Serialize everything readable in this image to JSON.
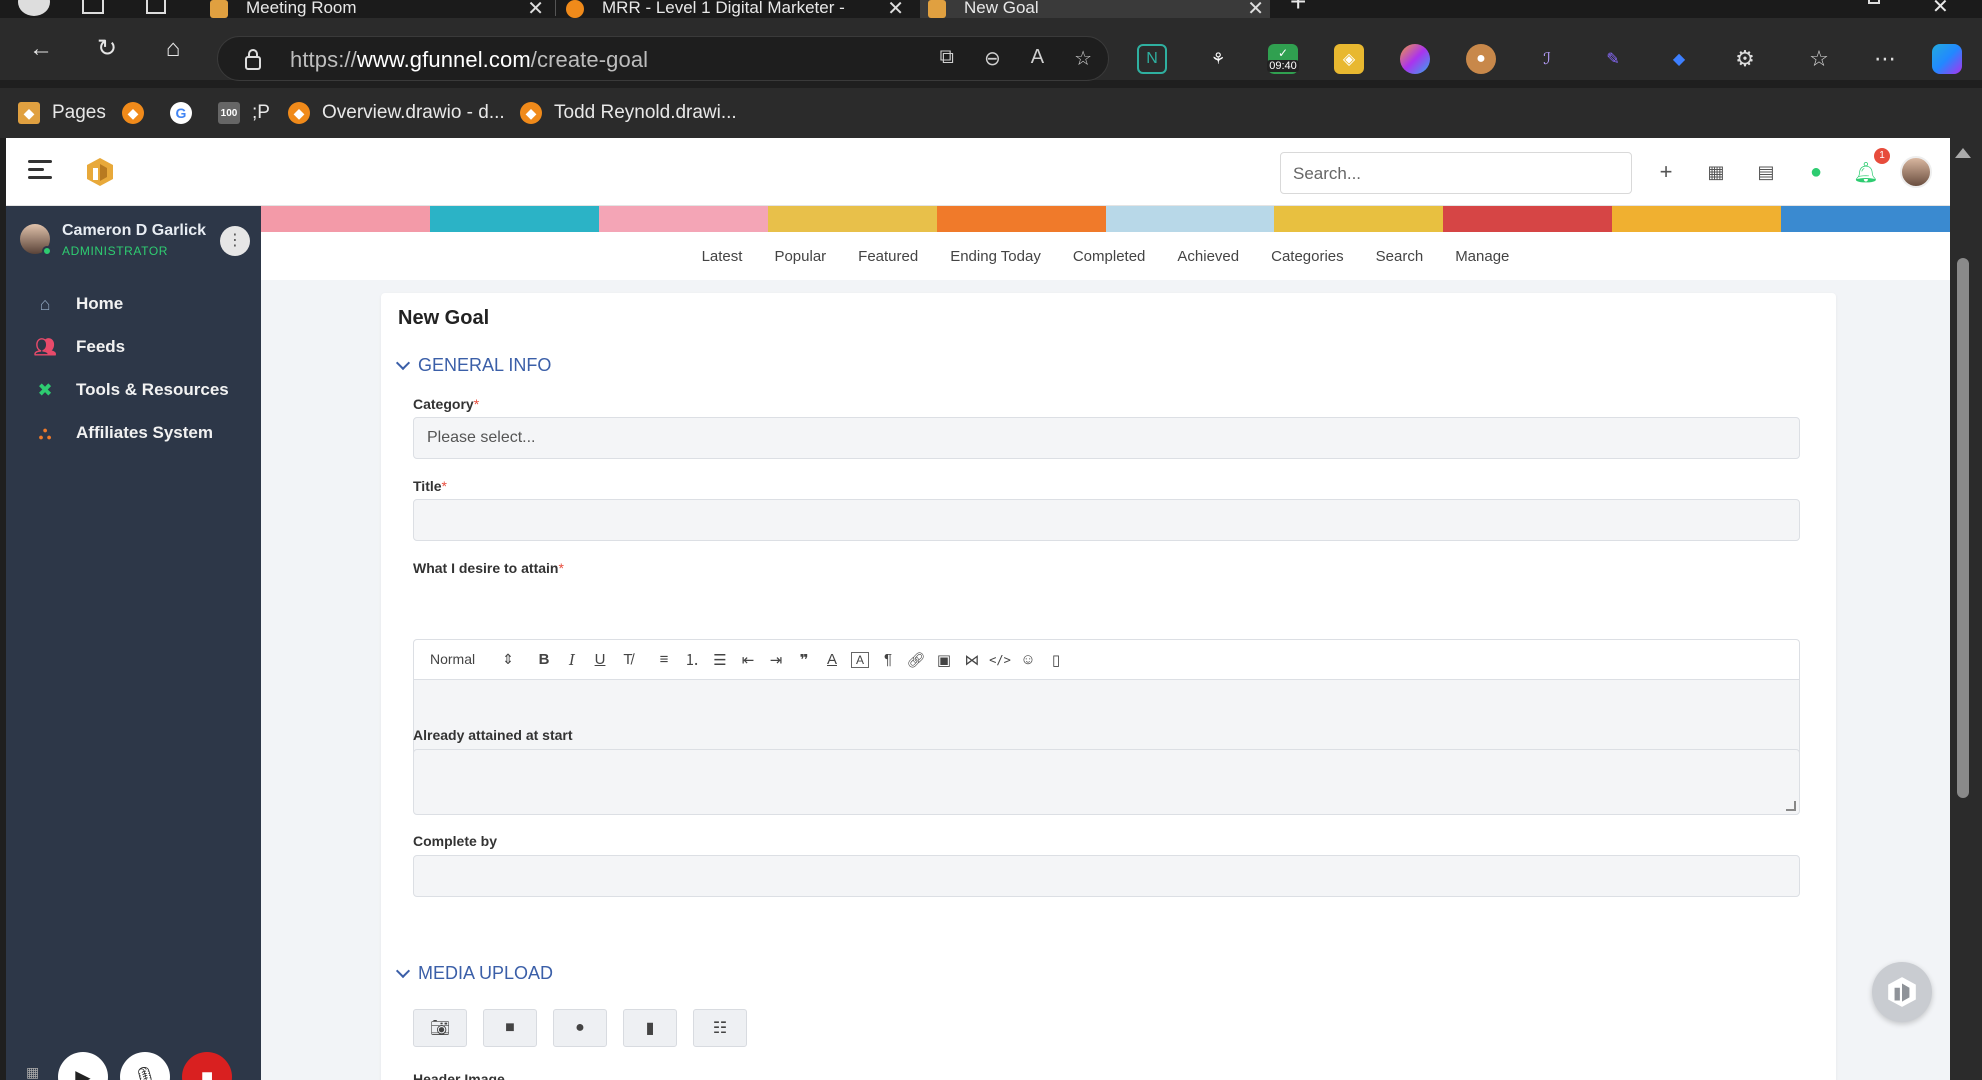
{
  "browser": {
    "tabs": [
      {
        "title": "Meeting Room"
      },
      {
        "title": "MRR - Level 1 Digital Marketer - "
      },
      {
        "title": "New Goal"
      }
    ],
    "url_prefix": "https://",
    "url_domain": "www.gfunnel.com",
    "url_path": "/create-goal",
    "extension_badge": "09:40",
    "bookmarks": [
      {
        "label": "Pages"
      },
      {
        "label": ""
      },
      {
        "label": ""
      },
      {
        "label": ";P"
      },
      {
        "label": "Overview.drawio - d..."
      },
      {
        "label": "Todd Reynold.drawi..."
      }
    ]
  },
  "app": {
    "search_placeholder": "Search...",
    "notification_count": "1",
    "user": {
      "name": "Cameron D Garlick",
      "role": "ADMINISTRATOR"
    },
    "sidebar": [
      {
        "label": "Home",
        "icon": "home-icon"
      },
      {
        "label": "Feeds",
        "icon": "users-icon"
      },
      {
        "label": "Tools & Resources",
        "icon": "tools-icon"
      },
      {
        "label": "Affiliates System",
        "icon": "sitemap-icon"
      }
    ],
    "subnav": [
      "Latest",
      "Popular",
      "Featured",
      "Ending Today",
      "Completed",
      "Achieved",
      "Categories",
      "Search",
      "Manage"
    ]
  },
  "form": {
    "title": "New Goal",
    "section_general": "GENERAL INFO",
    "category_label": "Category",
    "category_placeholder": "Please select...",
    "title_label": "Title",
    "desire_label": "What I desire to attain",
    "editor_format": "Normal",
    "attained_label": "Already attained at start",
    "complete_label": "Complete by",
    "section_media": "MEDIA UPLOAD",
    "header_image_label": "Header Image",
    "required_mark": "*"
  },
  "colors": {
    "sidebar_bg": "#2d3748",
    "accent_blue": "#3b5fa8",
    "online_green": "#2ecc71",
    "required_red": "#e74c3c"
  }
}
